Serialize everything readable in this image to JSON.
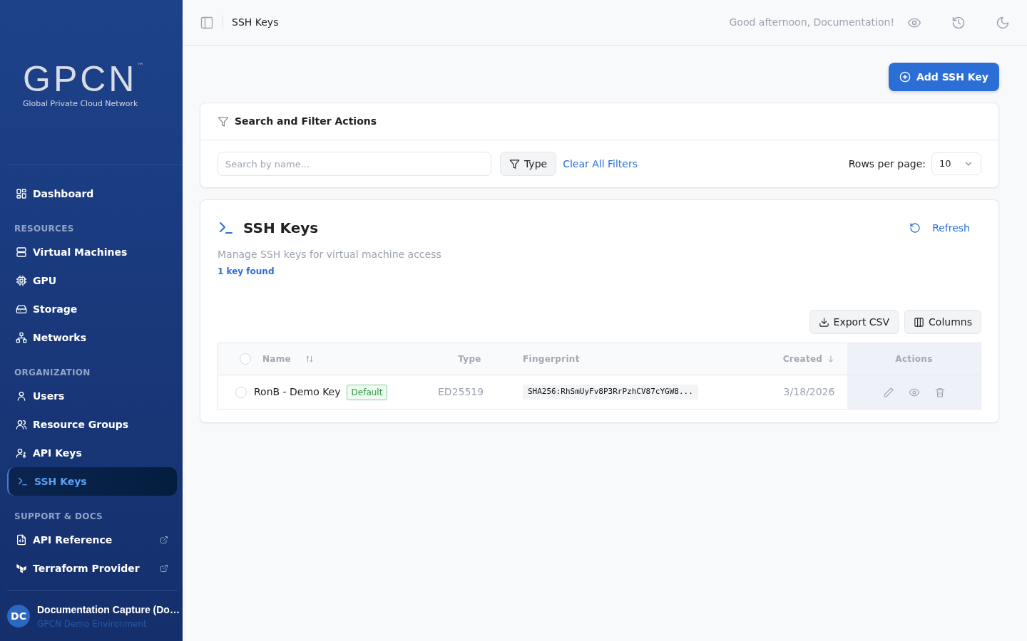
{
  "sidebar": {
    "logo": {
      "mark": "GPCN",
      "trademark": "™",
      "tagline": "Global Private Cloud Network"
    },
    "sections": [
      {
        "items": [
          {
            "label": "Dashboard",
            "selected": false,
            "external": false
          }
        ]
      },
      {
        "heading": "RESOURCES",
        "items": [
          {
            "label": "Virtual Machines",
            "selected": false,
            "external": false
          },
          {
            "label": "GPU",
            "selected": false,
            "external": false
          },
          {
            "label": "Storage",
            "selected": false,
            "external": false
          },
          {
            "label": "Networks",
            "selected": false,
            "external": false
          }
        ]
      },
      {
        "heading": "ORGANIZATION",
        "items": [
          {
            "label": "Users",
            "selected": false,
            "external": false
          },
          {
            "label": "Resource Groups",
            "selected": false,
            "external": false
          },
          {
            "label": "API Keys",
            "selected": false,
            "external": false
          },
          {
            "label": "SSH Keys",
            "selected": true,
            "external": false
          }
        ]
      },
      {
        "heading": "SUPPORT & DOCS",
        "items": [
          {
            "label": "API Reference",
            "selected": false,
            "external": true
          },
          {
            "label": "Terraform Provider",
            "selected": false,
            "external": true
          }
        ]
      }
    ],
    "user": {
      "initials": "DC",
      "name": "Documentation Capture (Do…",
      "org": "GPCN Demo Environment"
    }
  },
  "topbar": {
    "title": "SSH Keys",
    "greeting": "Good afternoon, Documentation!"
  },
  "add_button": "Add SSH Key",
  "filters": {
    "title": "Search and Filter Actions",
    "search": {
      "placeholder": "Search by name..."
    },
    "type_button": "Type",
    "clear_link": "Clear All Filters",
    "rows_label": "Rows per page:",
    "rows_value": "10"
  },
  "keys": {
    "title": "SSH Keys",
    "refresh": "Refresh",
    "description": "Manage SSH keys for virtual machine access",
    "count": "1 key found",
    "export": "Export CSV",
    "columns_button": "Columns",
    "table": {
      "select_all": false,
      "columns": [
        {
          "label": "Name",
          "sortable": true,
          "sorted": false
        },
        {
          "label": "Type",
          "sortable": false
        },
        {
          "label": "Fingerprint",
          "sortable": false
        },
        {
          "label": "Created",
          "sortable": true,
          "sorted": true
        },
        {
          "label": "Actions",
          "sortable": false
        }
      ],
      "rows": [
        {
          "name": "RonB - Demo Key",
          "badge": "Default",
          "type": "ED25519",
          "fingerprint": "SHA256:RhSmUyFv8P3RrPzhCV87cYGW8...",
          "created": "3/18/2026",
          "selected": false
        }
      ]
    }
  }
}
